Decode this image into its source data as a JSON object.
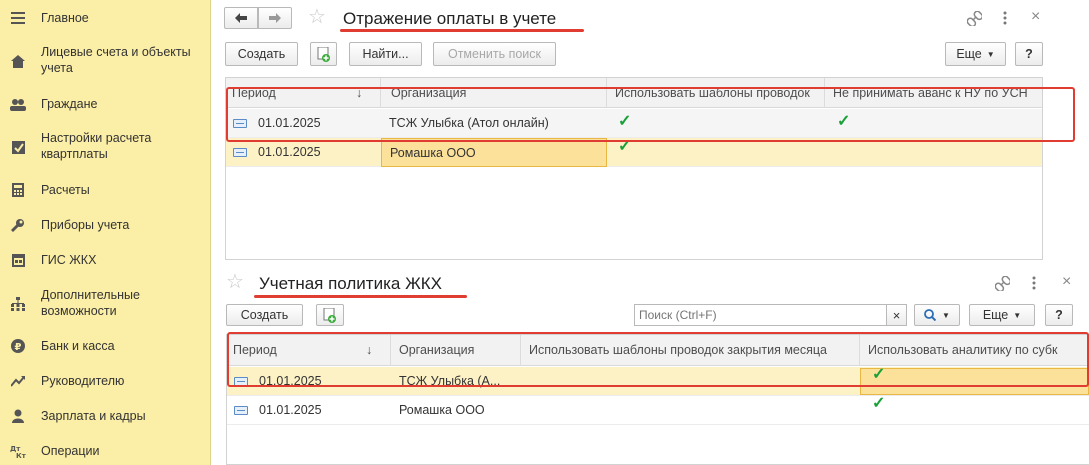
{
  "sidebar": {
    "items": [
      {
        "label": "Главное",
        "icon": "menu-icon",
        "glyph": "≡"
      },
      {
        "label": "Лицевые счета и объекты учета",
        "icon": "house-icon",
        "glyph": "⌂"
      },
      {
        "label": "Граждане",
        "icon": "people-icon",
        "glyph": "👥"
      },
      {
        "label": "Настройки расчета квартплаты",
        "icon": "checkbox-icon",
        "glyph": "☑"
      },
      {
        "label": "Расчеты",
        "icon": "calculator-icon",
        "glyph": "▦"
      },
      {
        "label": "Приборы учета",
        "icon": "wrench-icon",
        "glyph": "✱"
      },
      {
        "label": "ГИС ЖКХ",
        "icon": "calendar-icon",
        "glyph": "▤"
      },
      {
        "label": "Дополнительные возможности",
        "icon": "structure-icon",
        "glyph": "⋮"
      },
      {
        "label": "Банк и касса",
        "icon": "ruble-icon",
        "glyph": "₽"
      },
      {
        "label": "Руководителю",
        "icon": "chart-trend-icon",
        "glyph": "↗"
      },
      {
        "label": "Зарплата и кадры",
        "icon": "person-icon",
        "glyph": "●"
      },
      {
        "label": "Операции",
        "icon": "dt-kt-icon",
        "glyph": "Дт"
      }
    ]
  },
  "top": {
    "title": "Отражение оплаты в учете",
    "create": "Создать",
    "find": "Найти...",
    "cancel_search": "Отменить поиск",
    "more": "Еще",
    "help": "?",
    "columns": [
      "Период",
      "Организация",
      "Использовать шаблоны проводок",
      "Не принимать аванс к НУ по УСН"
    ],
    "sort_indicator": "↓",
    "rows": [
      {
        "period": "01.01.2025",
        "org": "ТСЖ Улыбка (Атол онлайн)",
        "templates": true,
        "advance": true
      },
      {
        "period": "01.01.2025",
        "org": "Ромашка ООО",
        "templates": true,
        "advance": false
      }
    ]
  },
  "bottom": {
    "title": "Учетная политика ЖКХ",
    "create": "Создать",
    "search_placeholder": "Поиск (Ctrl+F)",
    "clear": "×",
    "more": "Еще",
    "help": "?",
    "columns": [
      "Период",
      "Организация",
      "Использовать шаблоны проводок закрытия месяца",
      "Использовать аналитику по субк"
    ],
    "sort_indicator": "↓",
    "rows": [
      {
        "period": "01.01.2025",
        "org": "ТСЖ Улыбка (А...",
        "templates": false,
        "analytics": true
      },
      {
        "period": "01.01.2025",
        "org": "Ромашка ООО",
        "templates": false,
        "analytics": true
      }
    ]
  },
  "colors": {
    "sidebar": "#fbeea6",
    "accent_red": "#e03c31",
    "check_green": "#1aa038"
  }
}
